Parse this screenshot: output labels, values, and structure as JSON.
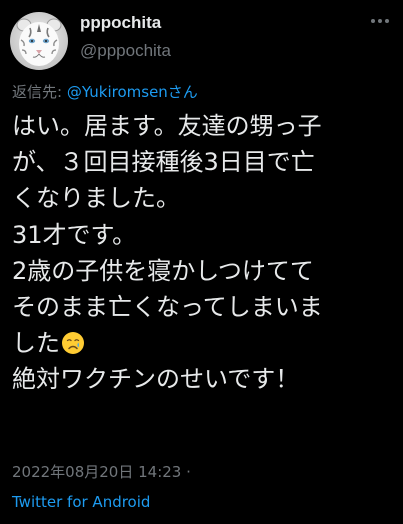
{
  "author": {
    "display_name": "pppochita",
    "handle": "@pppochita",
    "avatar_icon": "white-tiger-avatar-icon"
  },
  "reply": {
    "prefix": "返信先: ",
    "mention": "@Yukiromsenさん"
  },
  "tweet": {
    "lines": [
      "はい。居ます。友達の甥っ子",
      "が、３回目接種後3日目で亡",
      "くなりました。",
      "31才です。",
      "2歳の子供を寝かしつけてて",
      "そのまま亡くなってしまいま",
      "した",
      "絶対ワクチンのせいです！"
    ],
    "emoji_icon": "crying-face-emoji-icon"
  },
  "meta": {
    "timestamp": "2022年08月20日 14:23 ·",
    "source": "Twitter for Android"
  },
  "colors": {
    "background": "#000000",
    "text": "#e7e9ea",
    "secondary": "#71767b",
    "accent": "#1d9bf0"
  }
}
